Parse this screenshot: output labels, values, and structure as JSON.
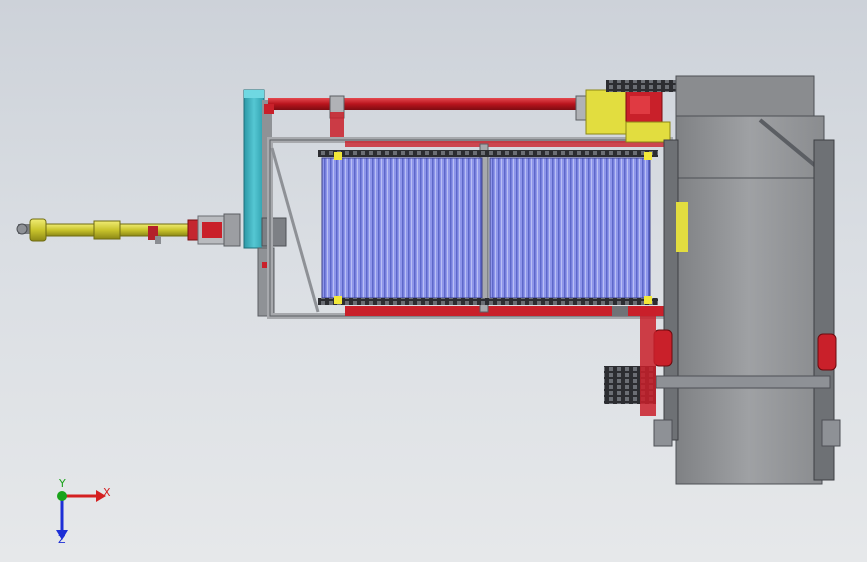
{
  "viewport": {
    "background_top": "#cdd2d9",
    "background_bottom": "#e6e8ea"
  },
  "colors": {
    "frame_red": "#c9202a",
    "frame_gray": "#a7a9ad",
    "frame_dark": "#5b5e63",
    "conveyor_blue": "#8a92e6",
    "hopper_gray": "#8e9093",
    "shaft_yellow": "#d8d43a",
    "panel_teal": "#3fb6c4",
    "gearbox_yellow": "#e9e44a"
  },
  "triad": {
    "x_label": "X",
    "y_label": "Y",
    "z_label": "Z",
    "x_color": "#d42020",
    "y_color": "#1aa31a",
    "z_color": "#1d2fd6"
  }
}
